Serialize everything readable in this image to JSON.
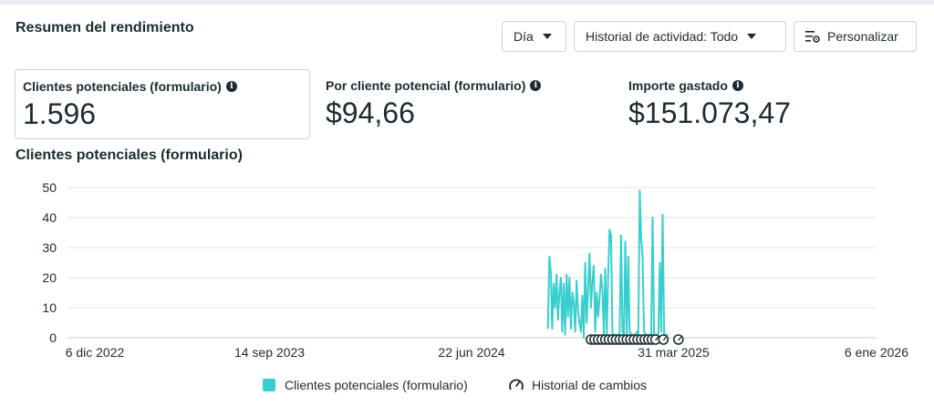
{
  "header": {
    "title": "Resumen del rendimiento",
    "day_label": "Día",
    "history_label": "Historial de actividad: Todo",
    "customize_label": "Personalizar"
  },
  "metrics": [
    {
      "label": "Clientes potenciales (formulario)",
      "value": "1.596"
    },
    {
      "label": "Por cliente potencial (formulario)",
      "value": "$94,66"
    },
    {
      "label": "Importe gastado",
      "value": "$151.073,47"
    }
  ],
  "chart_title": "Clientes potenciales (formulario)",
  "legend": {
    "series_label": "Clientes potenciales (formulario)",
    "history_label": "Historial de cambios"
  },
  "colors": {
    "series": "#37cfce",
    "text": "#1c2b33",
    "grid": "#dfe3e8"
  },
  "chart_data": {
    "type": "line",
    "title": "",
    "xlabel": "",
    "ylabel": "",
    "ylim": [
      0,
      50
    ],
    "yticks": [
      0,
      10,
      20,
      30,
      40,
      50
    ],
    "xticks": [
      "6 dic 2022",
      "14 sep 2023",
      "22 jun 2024",
      "31 mar 2025",
      "6 ene 2026"
    ],
    "xlim": [
      "2022-12-06",
      "2026-01-06"
    ],
    "grid": true,
    "legend_position": "bottom",
    "series": [
      {
        "name": "Clientes potenciales (formulario)",
        "x": [
          "2024-10-06",
          "2024-10-08",
          "2024-10-10",
          "2024-10-12",
          "2024-10-14",
          "2024-10-16",
          "2024-10-18",
          "2024-10-20",
          "2024-10-22",
          "2024-10-24",
          "2024-10-26",
          "2024-10-28",
          "2024-10-30",
          "2024-11-01",
          "2024-11-03",
          "2024-11-05",
          "2024-11-07",
          "2024-11-09",
          "2024-11-11",
          "2024-11-13",
          "2024-11-15",
          "2024-11-17",
          "2024-11-19",
          "2024-11-21",
          "2024-11-23",
          "2024-11-25",
          "2024-11-27",
          "2024-11-29",
          "2024-12-01",
          "2024-12-03",
          "2024-12-05",
          "2024-12-07",
          "2024-12-09",
          "2024-12-11",
          "2024-12-13",
          "2024-12-15",
          "2024-12-17",
          "2024-12-19",
          "2024-12-21",
          "2024-12-23",
          "2024-12-25",
          "2024-12-27",
          "2024-12-29",
          "2024-12-31",
          "2025-01-02",
          "2025-01-04",
          "2025-01-06",
          "2025-01-08",
          "2025-01-10",
          "2025-01-12",
          "2025-01-14",
          "2025-01-16",
          "2025-01-18",
          "2025-01-20",
          "2025-01-22",
          "2025-01-24",
          "2025-01-26",
          "2025-01-28",
          "2025-01-30",
          "2025-02-01",
          "2025-02-03",
          "2025-02-05",
          "2025-02-07",
          "2025-02-09",
          "2025-02-11",
          "2025-02-13",
          "2025-02-15",
          "2025-02-17",
          "2025-02-19",
          "2025-02-21",
          "2025-02-23",
          "2025-02-25",
          "2025-02-27",
          "2025-03-01",
          "2025-03-03",
          "2025-03-05",
          "2025-03-07",
          "2025-03-09",
          "2025-03-11",
          "2025-03-13",
          "2025-03-15",
          "2025-03-17",
          "2025-03-19",
          "2025-03-21",
          "2025-03-23"
        ],
        "y": [
          3,
          27,
          22,
          3,
          18,
          10,
          21,
          6,
          15,
          20,
          2,
          18,
          1,
          21,
          7,
          20,
          3,
          15,
          12,
          2,
          19,
          9,
          5,
          2,
          14,
          0,
          25,
          5,
          17,
          28,
          10,
          19,
          24,
          2,
          15,
          7,
          13,
          21,
          16,
          1,
          23,
          1,
          21,
          36,
          34,
          1,
          1,
          1,
          1,
          1,
          1,
          34,
          2,
          1,
          32,
          1,
          27,
          2,
          1,
          1,
          1,
          1,
          2,
          1,
          49,
          33,
          27,
          2,
          1,
          1,
          1,
          1,
          1,
          40,
          1,
          1,
          1,
          1,
          25,
          2,
          41,
          1,
          1,
          1,
          1
        ]
      }
    ],
    "history_markers": [
      "2024-12-05",
      "2024-12-10",
      "2024-12-15",
      "2024-12-20",
      "2024-12-25",
      "2024-12-30",
      "2025-01-04",
      "2025-01-09",
      "2025-01-14",
      "2025-01-19",
      "2025-01-24",
      "2025-01-29",
      "2025-02-03",
      "2025-02-08",
      "2025-02-13",
      "2025-02-18",
      "2025-02-23",
      "2025-02-28",
      "2025-03-05",
      "2025-03-16",
      "2025-04-06"
    ]
  }
}
